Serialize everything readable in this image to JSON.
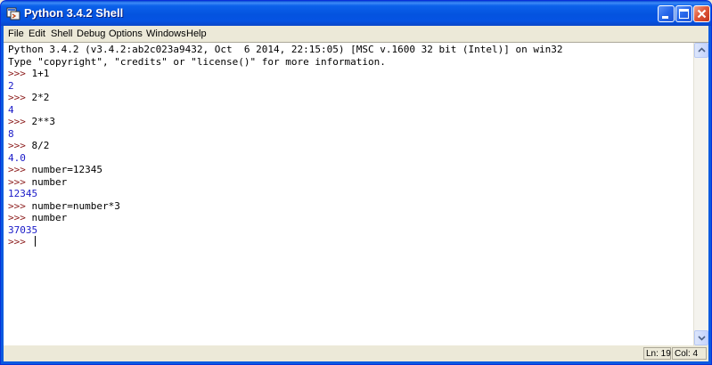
{
  "window": {
    "title": "Python 3.4.2 Shell"
  },
  "titlebar_buttons": {
    "minimize_icon": "minimize-icon",
    "maximize_icon": "maximize-icon",
    "close_icon": "close-icon"
  },
  "menu": {
    "items": [
      "File",
      "Edit",
      "Shell",
      "Debug",
      "Options",
      "Windows",
      "Help"
    ]
  },
  "shell": {
    "lines": [
      {
        "kind": "info",
        "text": "Python 3.4.2 (v3.4.2:ab2c023a9432, Oct  6 2014, 22:15:05) [MSC v.1600 32 bit (Intel)] on win32"
      },
      {
        "kind": "info",
        "text": "Type \"copyright\", \"credits\" or \"license()\" for more information."
      },
      {
        "kind": "input",
        "prompt": ">>> ",
        "text": "1+1"
      },
      {
        "kind": "output",
        "text": "2"
      },
      {
        "kind": "input",
        "prompt": ">>> ",
        "text": "2*2"
      },
      {
        "kind": "output",
        "text": "4"
      },
      {
        "kind": "input",
        "prompt": ">>> ",
        "text": "2**3"
      },
      {
        "kind": "output",
        "text": "8"
      },
      {
        "kind": "input",
        "prompt": ">>> ",
        "text": "8/2"
      },
      {
        "kind": "output",
        "text": "4.0"
      },
      {
        "kind": "input",
        "prompt": ">>> ",
        "text": "number=12345"
      },
      {
        "kind": "input",
        "prompt": ">>> ",
        "text": "number"
      },
      {
        "kind": "output",
        "text": "12345"
      },
      {
        "kind": "input",
        "prompt": ">>> ",
        "text": "number=number*3"
      },
      {
        "kind": "input",
        "prompt": ">>> ",
        "text": "number"
      },
      {
        "kind": "output",
        "text": "37035"
      },
      {
        "kind": "current",
        "prompt": ">>> ",
        "text": ""
      }
    ],
    "colors": {
      "prompt": "#8b1a1a",
      "output": "#1a1ac8",
      "input": "#000000"
    }
  },
  "status": {
    "line": "Ln: 19",
    "column": "Col: 4"
  }
}
